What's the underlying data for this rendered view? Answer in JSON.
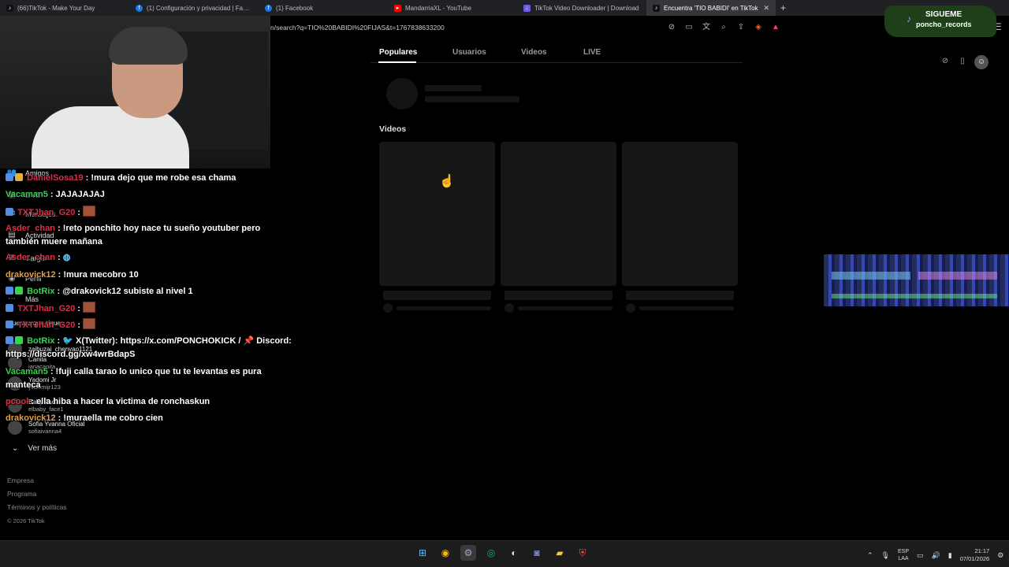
{
  "browser": {
    "tabs": [
      {
        "title": "(66)TikTok - Make Your Day",
        "icon": "tiktok-icon",
        "active": false
      },
      {
        "title": "(1) Configuración y privacidad | Facebook",
        "icon": "facebook-icon",
        "active": false
      },
      {
        "title": "(1) Facebook",
        "icon": "facebook-icon",
        "active": false
      },
      {
        "title": "MandarriaXL - YouTube",
        "icon": "youtube-icon",
        "active": false
      },
      {
        "title": "TikTok Video Downloader | Download",
        "icon": "downloader-icon",
        "active": false
      },
      {
        "title": "Encuentra 'TIO BABIDI' en TikTok",
        "icon": "tiktok-icon",
        "active": true
      }
    ],
    "url": "n/search?q=TIO%20BABIDI%20FIJAS&t=1767838633200"
  },
  "follow_banner": {
    "line1": "SIGUEME",
    "line2": "poncho_records"
  },
  "sidebar": {
    "items": [
      {
        "label": "Amigos",
        "icon": "friends-icon"
      },
      {
        "label": "LIVE",
        "icon": "live-icon"
      },
      {
        "label": "Mensajes",
        "icon": "messages-icon"
      },
      {
        "label": "Actividad",
        "icon": "activity-icon"
      },
      {
        "label": "Cargar",
        "icon": "upload-icon"
      },
      {
        "label": "Perfil",
        "icon": "profile-icon"
      },
      {
        "label": "Más",
        "icon": "more-icon"
      }
    ],
    "following_accounts": [
      {
        "name": "Cuentas que sigues",
        "sub": ""
      },
      {
        "name": "zaibuzai_chenyao1121",
        "sub": ""
      },
      {
        "name": "Canita",
        "sub": "ianacanita"
      },
      {
        "name": "Yadomi Jr",
        "sub": "yadomijr123"
      },
      {
        "name": "Baby Face",
        "sub": "elbaby_face1"
      },
      {
        "name": "Sofia Yvanna Oficial",
        "sub": "sofiaivanna4"
      }
    ],
    "see_more": "Ver más",
    "footer": [
      "Empresa",
      "Programa",
      "Términos y políticas"
    ],
    "copyright": "© 2026 TikTok"
  },
  "chat": [
    {
      "user": "DanielSosa19",
      "user_color": "#d9304a",
      "text": ": !mura dejo que me robe esa chama"
    },
    {
      "user": "Vacaman5",
      "user_color": "#39d353",
      "text": ": JAJAJAJAJ"
    },
    {
      "user": "TXTJhan_G20",
      "user_color": "#d9304a",
      "text": ":",
      "emote": true
    },
    {
      "user": "Asder_chan",
      "user_color": "#d9304a",
      "text": ": !reto ponchito hoy nace tu sueño youtuber pero",
      "cont": "también muere mañana"
    },
    {
      "user": "Asder_chan",
      "user_color": "#d9304a",
      "text": ":",
      "emote2": true
    },
    {
      "user": "drakovick12",
      "user_color": "#e0a040",
      "text": ": !mura mecobro 10"
    },
    {
      "user": "BotRix",
      "user_color": "#39d353",
      "text": ": @drakovick12 subiste al nivel 1"
    },
    {
      "user": "TXTJhan_G20",
      "user_color": "#d9304a",
      "text": ":",
      "emote": true
    },
    {
      "user": "TXTJhan_G20",
      "user_color": "#d9304a",
      "text": ":",
      "emote": true
    },
    {
      "user": "BotRix",
      "user_color": "#39d353",
      "text": ": 🐦 X(Twitter): https://x.com/PONCHOKICK / 📌 Discord:",
      "cont": "https://discord.gg/xw4wrBdapS"
    },
    {
      "user": "Vacaman5",
      "user_color": "#39d353",
      "text": ": !fuji calla tarao lo unico que tu te levantas es pura",
      "cont": "manteca"
    },
    {
      "user": "pcool",
      "user_color": "#d9304a",
      "text": ": ella hiba a hacer la victima de ronchaskun"
    },
    {
      "user": "drakovick12",
      "user_color": "#e0a040",
      "text": ": !muraella me cobro cien"
    }
  ],
  "main": {
    "tabs": [
      "Populares",
      "Usuarios",
      "Videos",
      "LIVE"
    ],
    "selected_tab": "Populares",
    "videos_title": "Videos"
  },
  "taskbar": {
    "apps": [
      "windows-start-icon",
      "chrome-icon",
      "steam-icon",
      "spotify-icon",
      "obs-icon",
      "discord-icon",
      "file-explorer-icon",
      "brave-icon"
    ],
    "lang_top": "ESP",
    "lang_bottom": "LAA",
    "time": "21:17",
    "date": "07/01/2026"
  }
}
